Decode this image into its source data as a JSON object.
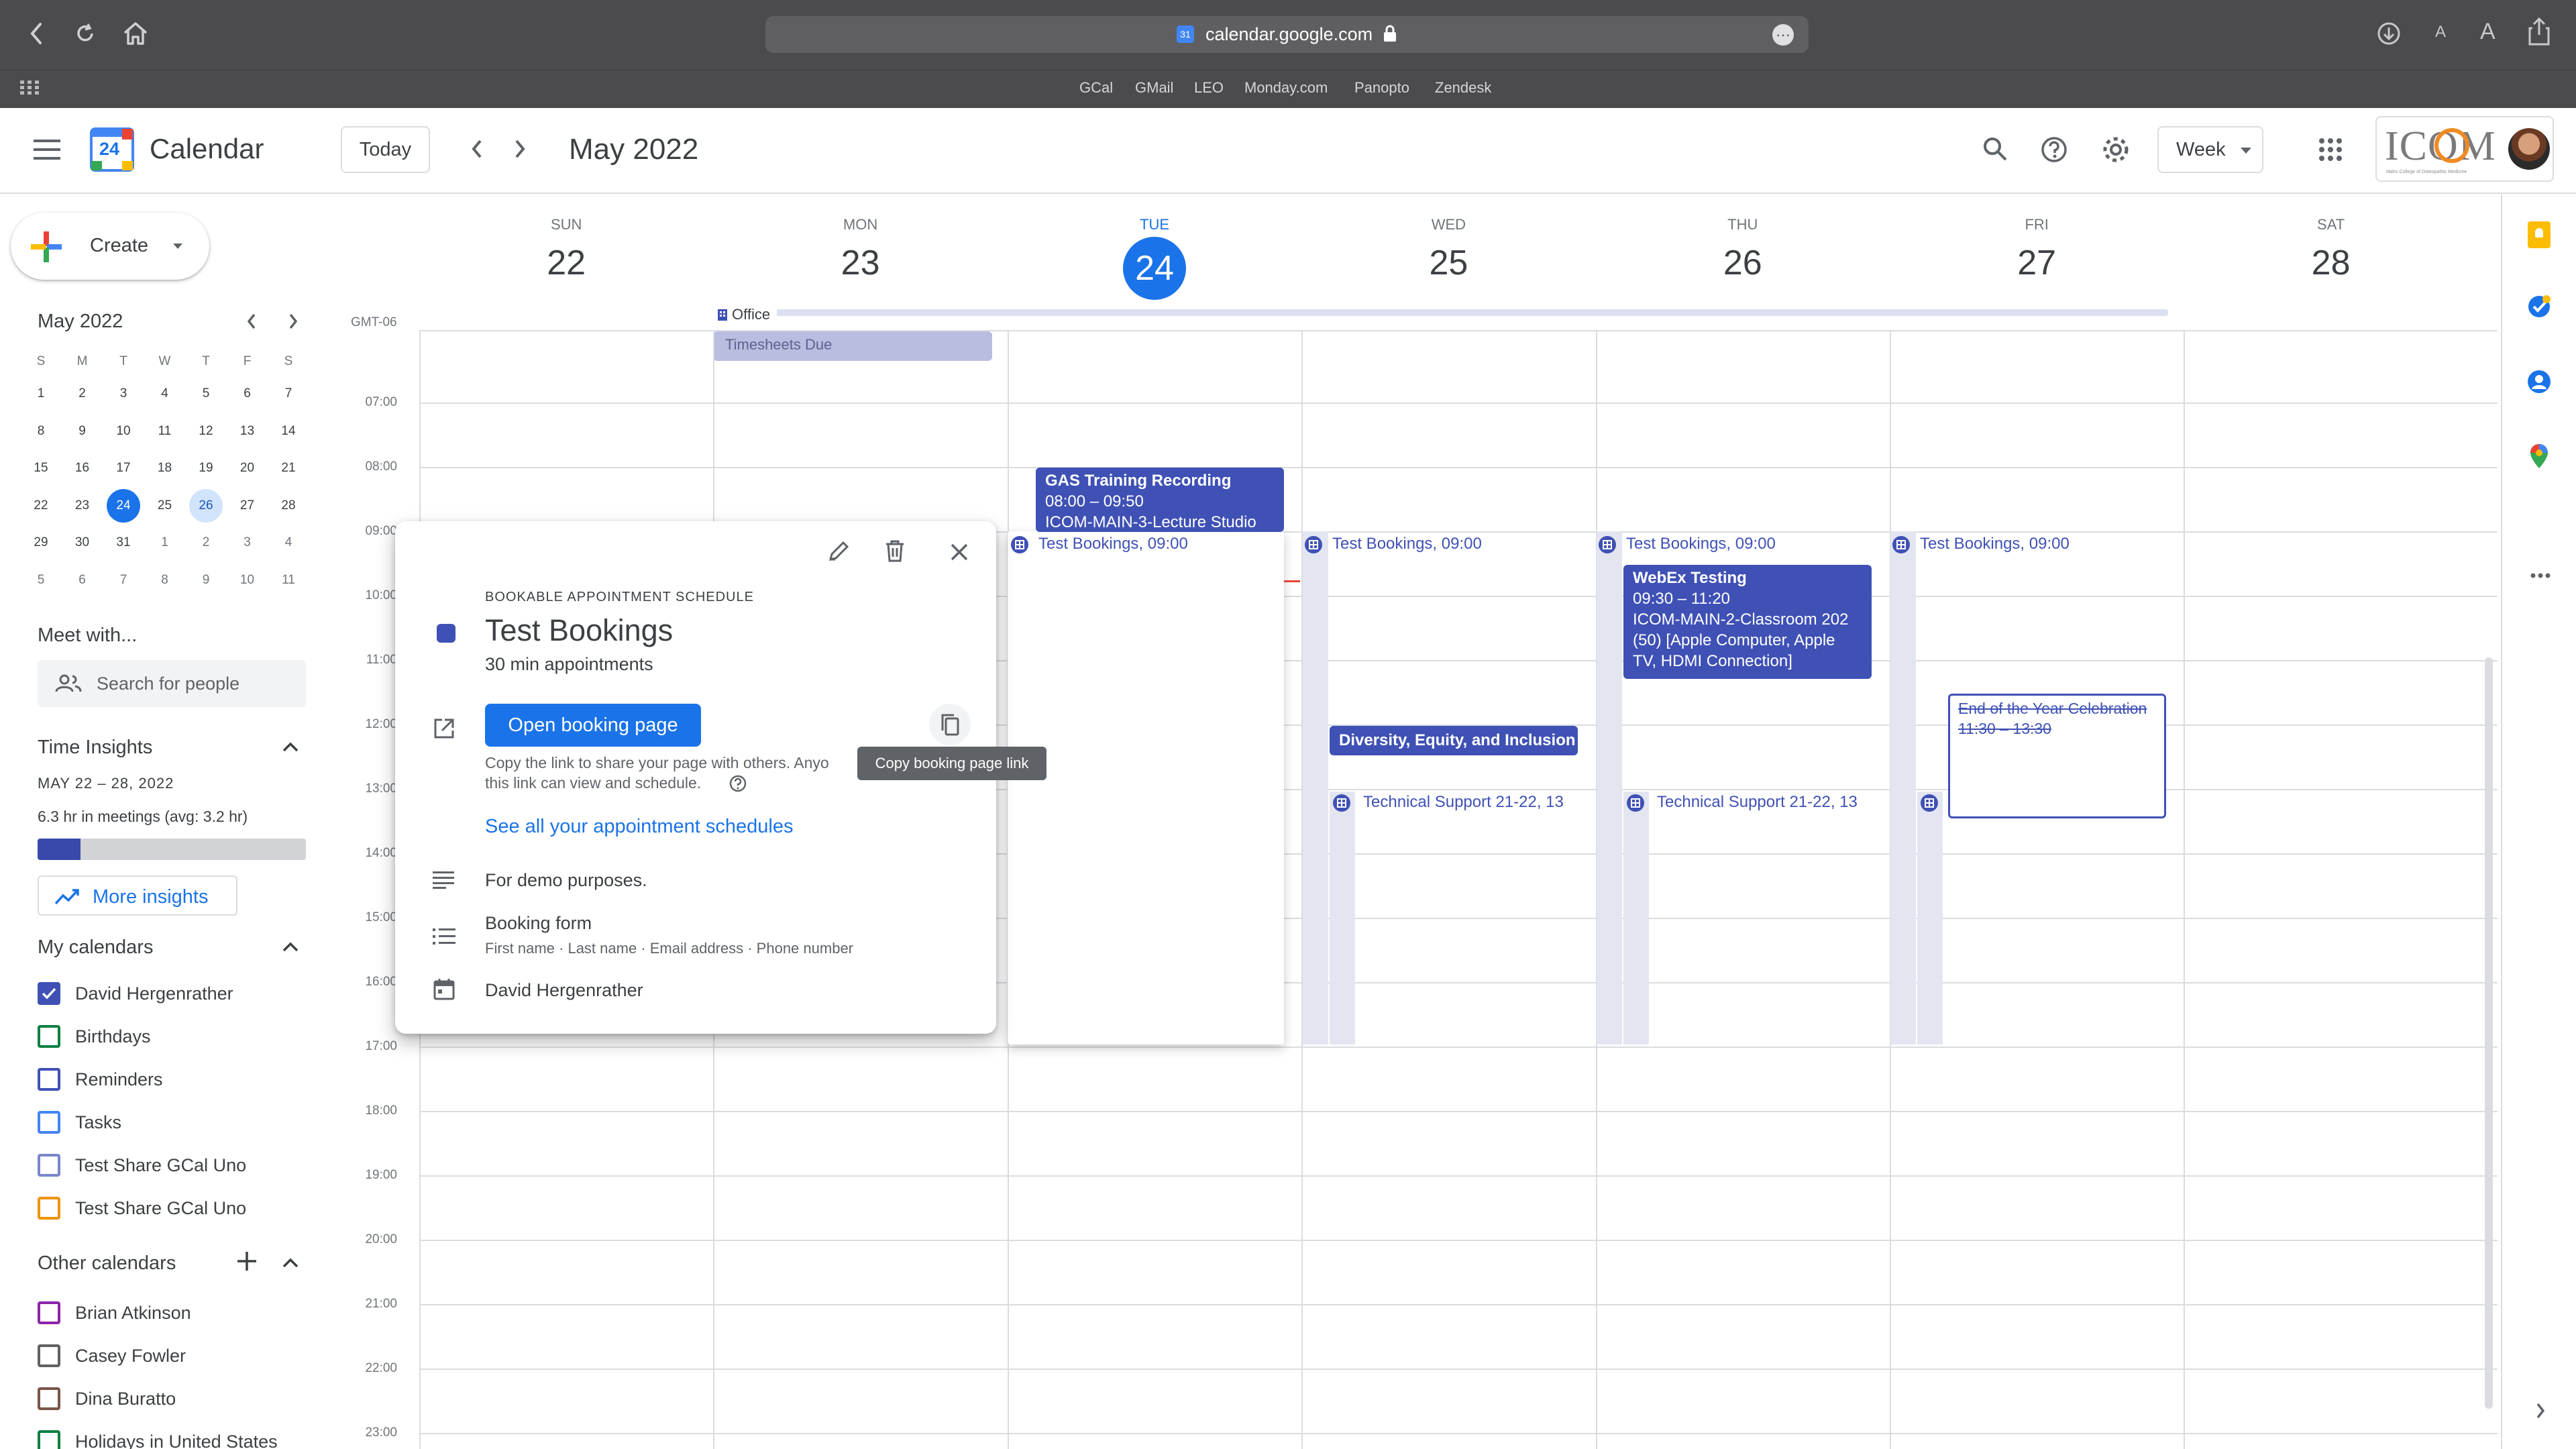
{
  "browser": {
    "url": "calendar.google.com",
    "bookmarks": [
      "GCal",
      "GMail",
      "LEO",
      "Monday.com",
      "Panopto",
      "Zendesk"
    ],
    "font_size_small": "A",
    "font_size_large": "A"
  },
  "header": {
    "app_name": "Calendar",
    "logo_day": "24",
    "today_label": "Today",
    "month_title": "May 2022",
    "view_label": "Week",
    "org_logo_text": "ICOM",
    "org_logo_sub": "Idaho College of Osteopathic Medicine"
  },
  "sidebar": {
    "create_label": "Create",
    "mini_calendar": {
      "title": "May 2022",
      "weekdays": [
        "S",
        "M",
        "T",
        "W",
        "T",
        "F",
        "S"
      ],
      "weeks": [
        [
          "1",
          "2",
          "3",
          "4",
          "5",
          "6",
          "7"
        ],
        [
          "8",
          "9",
          "10",
          "11",
          "12",
          "13",
          "14"
        ],
        [
          "15",
          "16",
          "17",
          "18",
          "19",
          "20",
          "21"
        ],
        [
          "22",
          "23",
          "24",
          "25",
          "26",
          "27",
          "28"
        ],
        [
          "29",
          "30",
          "31",
          "1",
          "2",
          "3",
          "4"
        ],
        [
          "5",
          "6",
          "7",
          "8",
          "9",
          "10",
          "11"
        ]
      ],
      "today": "24",
      "highlighted": "26"
    },
    "meet_with": {
      "title": "Meet with...",
      "search_placeholder": "Search for people"
    },
    "time_insights": {
      "title": "Time Insights",
      "range": "MAY 22 – 28, 2022",
      "summary": "6.3 hr in meetings (avg: 3.2 hr)",
      "meeting_fraction": 0.16,
      "more_label": "More insights"
    },
    "my_calendars": {
      "title": "My calendars",
      "items": [
        {
          "label": "David Hergenrather",
          "color": "#3f51b5",
          "checked": true
        },
        {
          "label": "Birthdays",
          "color": "#0b8043",
          "checked": false
        },
        {
          "label": "Reminders",
          "color": "#3f51b5",
          "checked": false
        },
        {
          "label": "Tasks",
          "color": "#4285f4",
          "checked": false
        },
        {
          "label": "Test Share GCal Uno",
          "color": "#7986cb",
          "checked": false
        },
        {
          "label": "Test Share GCal Uno",
          "color": "#f09300",
          "checked": false
        }
      ]
    },
    "other_calendars": {
      "title": "Other calendars",
      "items": [
        {
          "label": "Brian Atkinson",
          "color": "#8e24aa"
        },
        {
          "label": "Casey Fowler",
          "color": "#616161"
        },
        {
          "label": "Dina Buratto",
          "color": "#795548"
        },
        {
          "label": "Holidays in United States",
          "color": "#0b8043"
        }
      ]
    }
  },
  "grid": {
    "timezone": "GMT-06",
    "days": [
      {
        "name": "SUN",
        "num": "22"
      },
      {
        "name": "MON",
        "num": "23"
      },
      {
        "name": "TUE",
        "num": "24"
      },
      {
        "name": "WED",
        "num": "25"
      },
      {
        "name": "THU",
        "num": "26"
      },
      {
        "name": "FRI",
        "num": "27"
      },
      {
        "name": "SAT",
        "num": "28"
      }
    ],
    "hours": [
      "07:00",
      "08:00",
      "09:00",
      "10:00",
      "11:00",
      "12:00",
      "13:00",
      "14:00",
      "15:00",
      "16:00",
      "17:00",
      "18:00",
      "19:00",
      "20:00",
      "21:00",
      "22:00",
      "23:00"
    ],
    "allday": {
      "office_label": "Office",
      "timesheets_label": "Timesheets Due"
    },
    "events": {
      "gas_title": "GAS Training Recording",
      "gas_time": "08:00 – 09:50",
      "gas_location": "ICOM-MAIN-3-Lecture Studio",
      "test_bookings_label": "Test Bookings",
      "test_bookings_time": ", 09:00",
      "webex_title": "WebEx Testing",
      "webex_time": "09:30 – 11:20",
      "webex_location": "ICOM-MAIN-2-Classroom 202 (50) [Apple Computer, Apple TV, HDMI Connection]",
      "dei_title": "Diversity, Equity, and Inclusion C",
      "tech_support_label": "Technical Support 21-22",
      "tech_support_time": ", 13",
      "celebration_title": "End of the Year Celebration",
      "celebration_time": "11:30 – 13:30"
    }
  },
  "popup": {
    "kind_label": "BOOKABLE APPOINTMENT SCHEDULE",
    "title": "Test Bookings",
    "subtitle": "30 min appointments",
    "open_button": "Open booking page",
    "copy_tooltip": "Copy booking page link",
    "share_line1": "Copy the link to share your page with others. Anyo",
    "share_line2": "this link can view and schedule.",
    "see_all_link": "See all your appointment schedules",
    "description": "For demo purposes.",
    "form_title": "Booking form",
    "form_fields": "First name · Last name · Email address · Phone number",
    "owner": "David Hergenrather",
    "color": "#3f51b5"
  }
}
